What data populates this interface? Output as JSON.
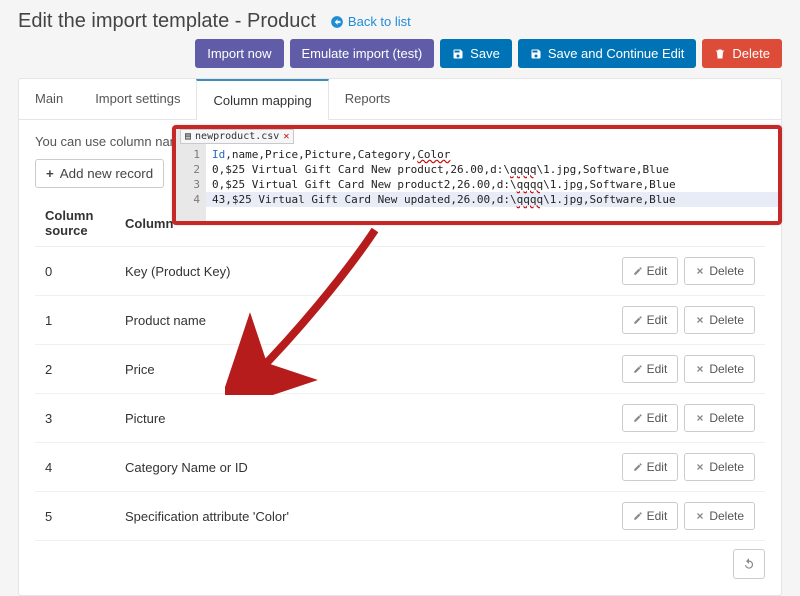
{
  "header": {
    "title": "Edit the import template - Product",
    "back_label": "Back to list"
  },
  "toolbar": {
    "import_now": "Import now",
    "emulate": "Emulate import (test)",
    "save": "Save",
    "save_continue": "Save and Continue Edit",
    "delete": "Delete"
  },
  "tabs": {
    "main": "Main",
    "settings": "Import settings",
    "mapping": "Column mapping",
    "reports": "Reports"
  },
  "mapping": {
    "hint": "You can use column name",
    "add_label": "Add new record",
    "col_source": "Column source",
    "col_name": "Column",
    "edit_label": "Edit",
    "delete_label": "Delete",
    "rows": [
      {
        "src": "0",
        "name": "Key (Product Key)"
      },
      {
        "src": "1",
        "name": "Product name"
      },
      {
        "src": "2",
        "name": "Price"
      },
      {
        "src": "3",
        "name": "Picture"
      },
      {
        "src": "4",
        "name": "Category Name or ID"
      },
      {
        "src": "5",
        "name": "Specification attribute 'Color'"
      }
    ]
  },
  "callout": {
    "filename": "newproduct.csv",
    "lines": [
      {
        "n": "1",
        "text": "Id,name,Price,Picture,Category,Color"
      },
      {
        "n": "2",
        "text": "0,$25 Virtual Gift Card New product,26.00,d:\\qqqq\\1.jpg,Software,Blue"
      },
      {
        "n": "3",
        "text": "0,$25 Virtual Gift Card New product2,26.00,d:\\qqqq\\1.jpg,Software,Blue"
      },
      {
        "n": "4",
        "text": "43,$25 Virtual Gift Card New updated,26.00,d:\\qqqq\\1.jpg,Software,Blue"
      }
    ]
  }
}
